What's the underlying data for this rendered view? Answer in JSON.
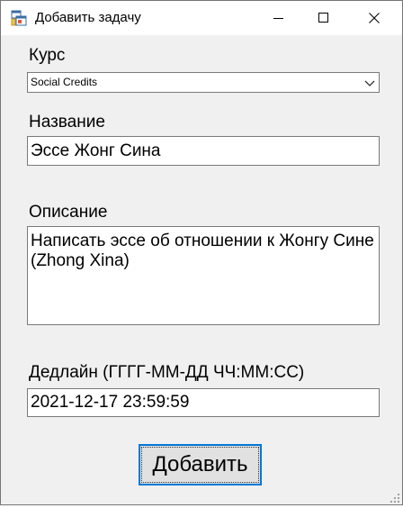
{
  "window": {
    "title": "Добавить задачу",
    "icon": "forms-app-icon"
  },
  "titlebar_controls": {
    "minimize": "minimize-icon",
    "maximize": "maximize-icon",
    "close": "close-icon"
  },
  "form": {
    "course_label": "Курс",
    "course_value": "Social Credits",
    "name_label": "Название",
    "name_value": "Эссе Жонг Сина",
    "description_label": "Описание",
    "description_value": "Написать эссе об отношении к Жонгу Сине (Zhong Xina)",
    "deadline_label": "Дедлайн (ГГГГ-ММ-ДД ЧЧ:ММ:СС)",
    "deadline_value": "2021-12-17 23:59:59",
    "submit_label": "Добавить"
  },
  "colors": {
    "accent": "#0078d7",
    "window_bg": "#f0f0f0",
    "field_border": "#7a7a7a"
  }
}
